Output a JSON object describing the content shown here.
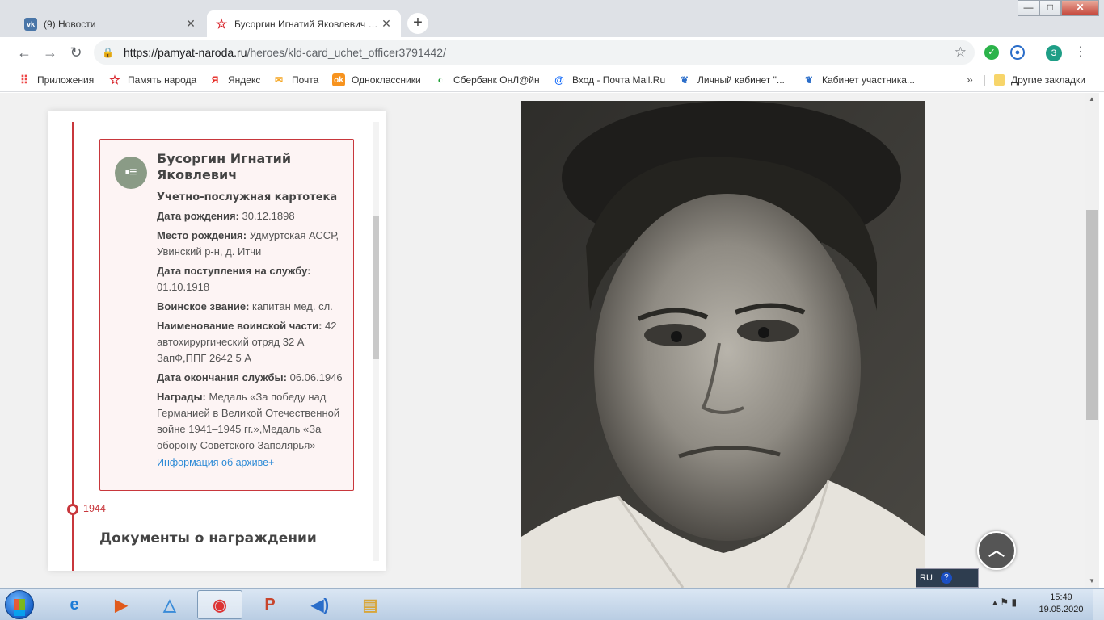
{
  "browser": {
    "tabs": [
      {
        "title": "(9) Новости",
        "icon": "vk-icon",
        "active": false
      },
      {
        "title": "Бусоргин Игнатий Яковлевич :: Па",
        "icon": "star-icon",
        "active": true
      }
    ],
    "new_tab_label": "+",
    "window_controls": {
      "minimize": "—",
      "maximize": "□",
      "close": "✕"
    },
    "address": {
      "host": "https://pamyat-naroda.ru",
      "path": "/heroes/kld-card_uchet_officer3791442/"
    },
    "extensions": {
      "avatar_letter": "З"
    },
    "bookmarks": [
      {
        "label": "Приложения",
        "icon": "apps-grid-icon"
      },
      {
        "label": "Память народа",
        "icon": "star-icon"
      },
      {
        "label": "Яндекс",
        "icon": "yandex-icon"
      },
      {
        "label": "Почта",
        "icon": "mail-icon"
      },
      {
        "label": "Одноклассники",
        "icon": "ok-icon"
      },
      {
        "label": "Сбербанк ОнЛ@йн",
        "icon": "sberbank-icon"
      },
      {
        "label": "Вход - Почта Mail.Ru",
        "icon": "mailru-icon"
      },
      {
        "label": "Личный кабинет \"...",
        "icon": "rostelecom-icon"
      },
      {
        "label": "Кабинет участника...",
        "icon": "rostelecom-icon"
      }
    ],
    "bookmarks_more": "»",
    "other_bookmarks": "Другие закладки"
  },
  "record": {
    "name": "Бусоргин Игнатий Яковлевич",
    "type": "Учетно-послужная картотека",
    "fields": [
      {
        "label": "Дата рождения:",
        "value": " 30.12.1898"
      },
      {
        "label": "Место рождения:",
        "value": " Удмуртская АССР, Увинский р-н, д. Итчи"
      },
      {
        "label": "Дата поступления на службу:",
        "value": " 01.10.1918"
      },
      {
        "label": "Воинское звание:",
        "value": " капитан мед. сл."
      },
      {
        "label": "Наименование воинской части:",
        "value": " 42 автохирургический отряд 32 А ЗапФ,ППГ 2642 5 А"
      },
      {
        "label": "Дата окончания службы:",
        "value": " 06.06.1946"
      },
      {
        "label": "Награды:",
        "value": " Медаль «За победу над Германией в Великой Отечественной войне 1941–1945 гг.»,Медаль «За оборону Советского Заполярья»"
      }
    ],
    "archive_link": "Информация об архиве+"
  },
  "timeline": {
    "year": "1944",
    "section_title": "Документы о награждении"
  },
  "scroll_up_label": "︿",
  "langbar": {
    "lang": "RU",
    "help": "?"
  },
  "taskbar": {
    "time": "15:49",
    "date": "19.05.2020"
  }
}
